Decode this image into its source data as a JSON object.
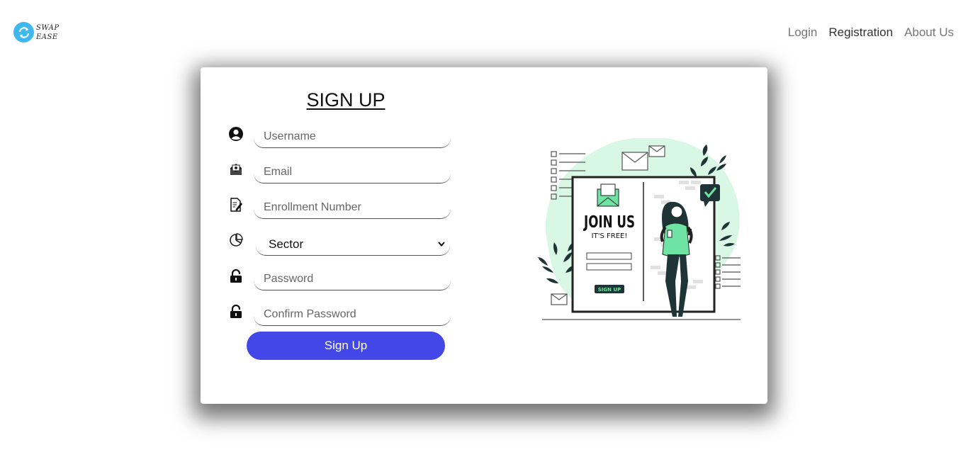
{
  "brand": {
    "line1": "SWAP",
    "line2": "EASE"
  },
  "nav": {
    "items": [
      "Login",
      "Registration",
      "About Us"
    ]
  },
  "form": {
    "title": "SIGN UP",
    "username_placeholder": "Username",
    "email_placeholder": "Email",
    "enrollment_placeholder": "Enrollment Number",
    "sector_value": "Sector",
    "password_placeholder": "Password",
    "confirm_password_placeholder": "Confirm Password",
    "submit_label": "Sign Up"
  },
  "illustration": {
    "headline": "JOIN US",
    "subline": "IT'S FREE!",
    "button": "SIGN UP"
  },
  "colors": {
    "accent": "#4347e8",
    "logo": "#3fb8ee",
    "illustration_green": "#6fe3a4",
    "illustration_mint": "#d8f8e5"
  }
}
